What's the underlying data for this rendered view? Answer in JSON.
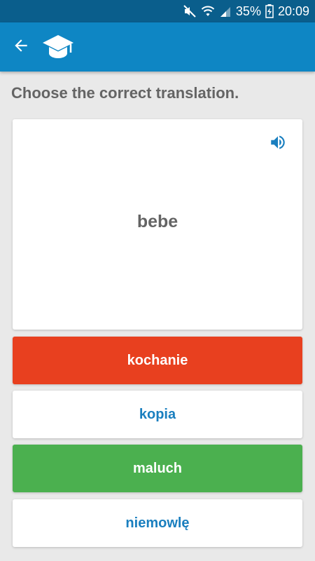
{
  "status": {
    "battery": "35%",
    "time": "20:09",
    "icons": [
      "mute-icon",
      "wifi-icon",
      "signal-icon",
      "battery-icon"
    ]
  },
  "app_bar": {
    "back_icon": "arrow-left-icon",
    "logo_icon": "graduation-cap-icon"
  },
  "quiz": {
    "prompt": "Choose the correct translation.",
    "word": "bebe",
    "speaker_icon": "speaker-icon",
    "options": [
      {
        "label": "kochanie",
        "state": "wrong",
        "color": "#e8401f"
      },
      {
        "label": "kopia",
        "state": "neutral",
        "color": "#ffffff"
      },
      {
        "label": "maluch",
        "state": "correct",
        "color": "#4bb04f"
      },
      {
        "label": "niemowlę",
        "state": "neutral",
        "color": "#ffffff"
      }
    ]
  },
  "colors": {
    "status_bar": "#0a5e8c",
    "app_bar": "#0e86c4",
    "background": "#e9e9e9",
    "text_gray": "#646464",
    "link_blue": "#1a7fbf"
  }
}
